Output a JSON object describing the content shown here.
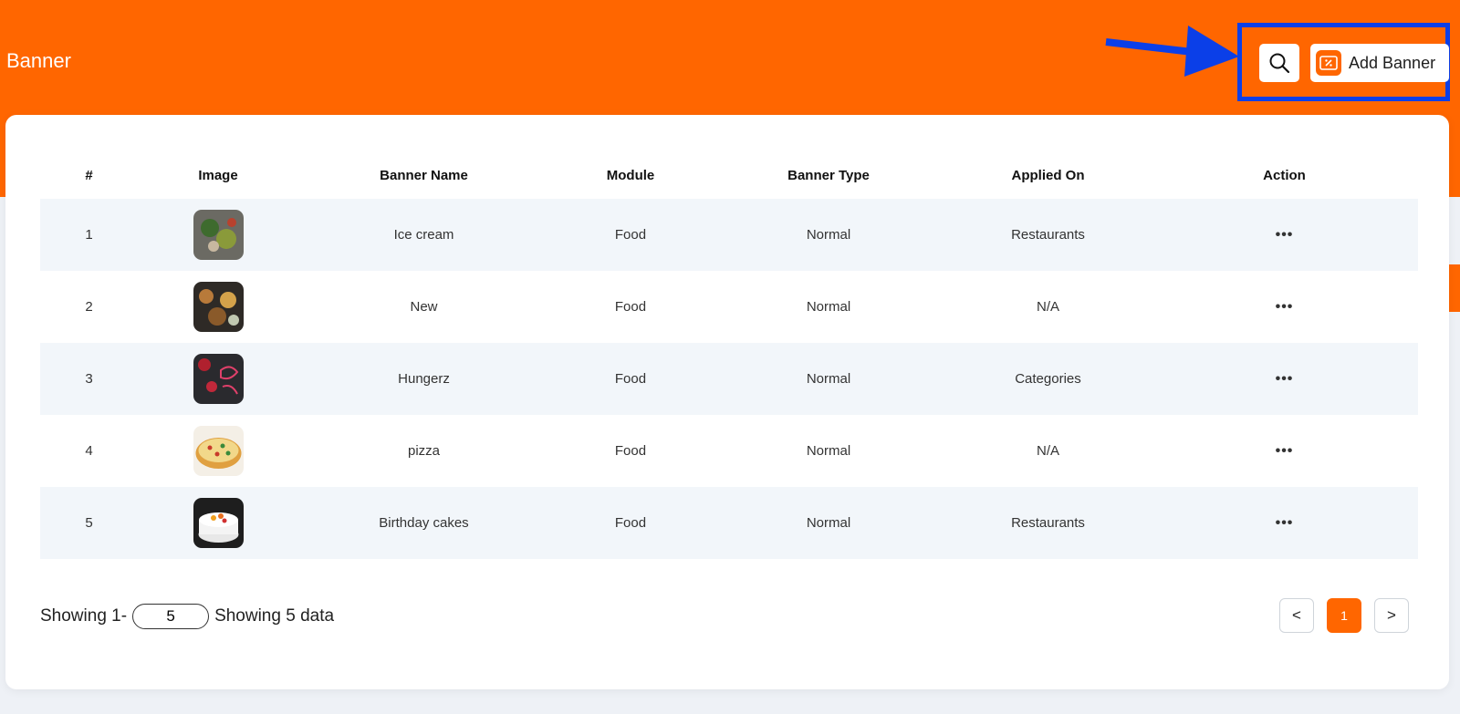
{
  "header": {
    "title": "Banner",
    "add_button_label": "Add Banner",
    "accent_color": "#ff6600",
    "annotation_color": "#0b3fe8"
  },
  "icons": {
    "search": "search-icon",
    "add_banner": "coupon-icon",
    "settings": "sliders-icon",
    "action": "more-horizontal-icon",
    "prev": "prev-page",
    "next": "next-page"
  },
  "table": {
    "columns": [
      "#",
      "Image",
      "Banner Name",
      "Module",
      "Banner Type",
      "Applied On",
      "Action"
    ],
    "rows": [
      {
        "index": "1",
        "name": "Ice cream",
        "module": "Food",
        "type": "Normal",
        "applied_on": "Restaurants",
        "action": "•••"
      },
      {
        "index": "2",
        "name": "New",
        "module": "Food",
        "type": "Normal",
        "applied_on": "N/A",
        "action": "•••"
      },
      {
        "index": "3",
        "name": "Hungerz",
        "module": "Food",
        "type": "Normal",
        "applied_on": "Categories",
        "action": "•••"
      },
      {
        "index": "4",
        "name": "pizza",
        "module": "Food",
        "type": "Normal",
        "applied_on": "N/A",
        "action": "•••"
      },
      {
        "index": "5",
        "name": "Birthday cakes",
        "module": "Food",
        "type": "Normal",
        "applied_on": "Restaurants",
        "action": "•••"
      }
    ]
  },
  "footer": {
    "showing_prefix": "Showing 1-",
    "per_page_value": "5",
    "showing_suffix": "Showing 5 data",
    "pagination": {
      "prev_label": "<",
      "current_page": "1",
      "next_label": ">"
    }
  }
}
